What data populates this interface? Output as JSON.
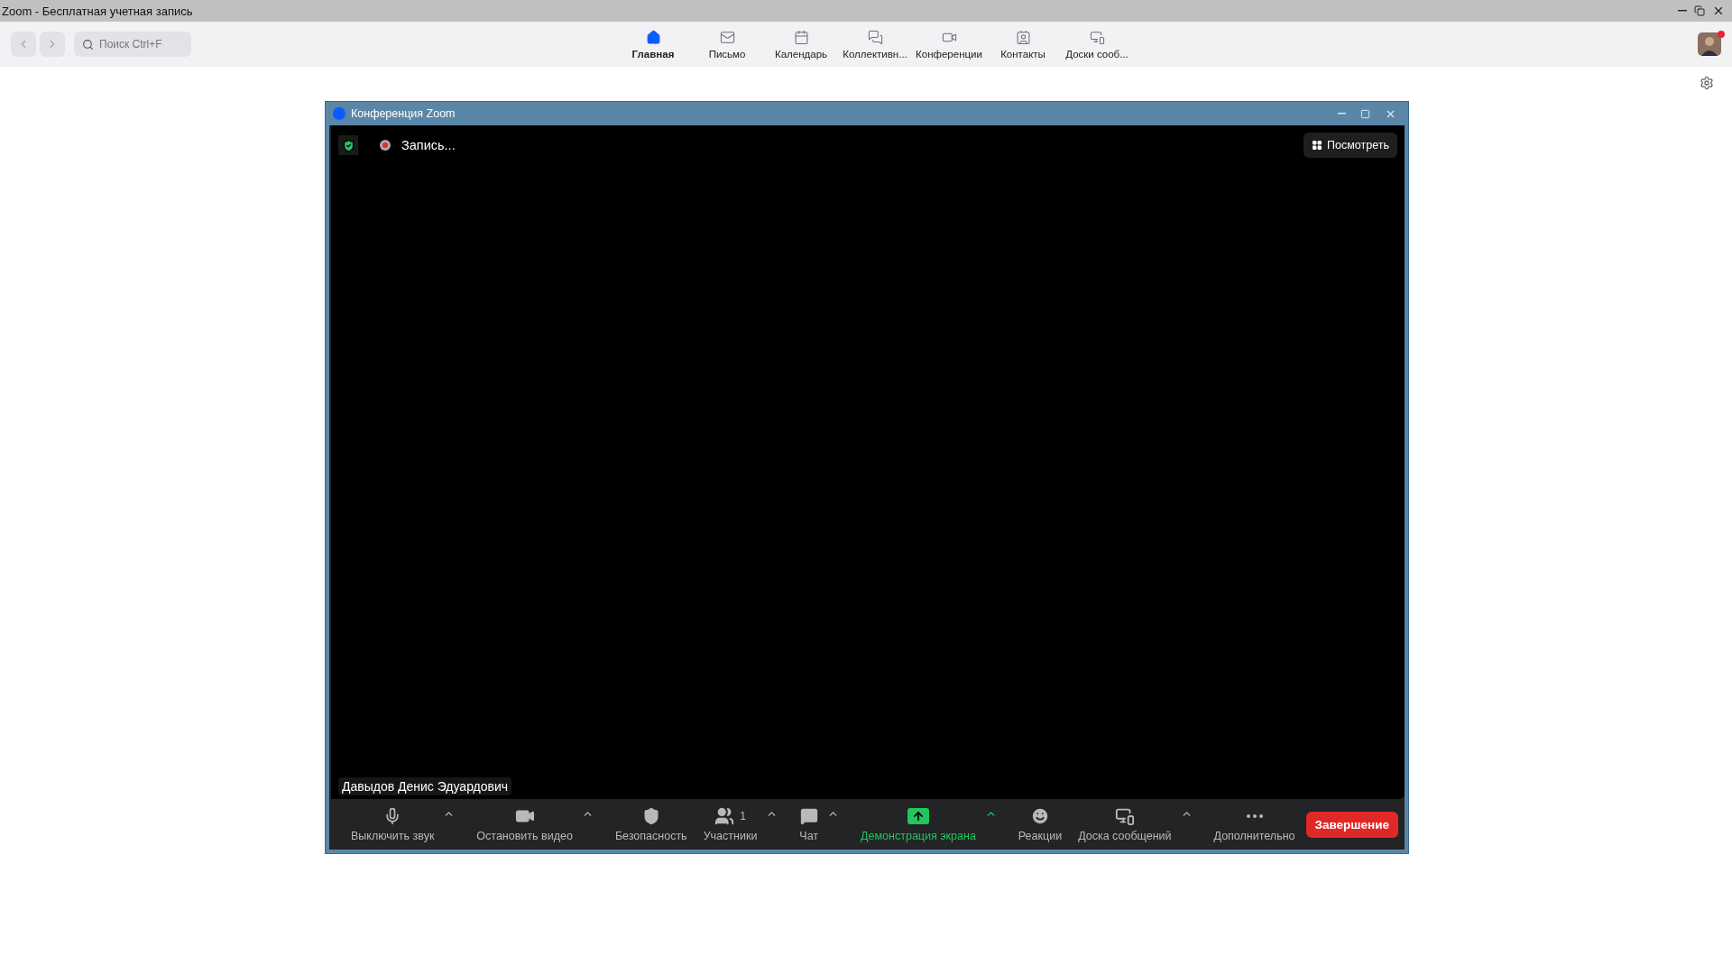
{
  "app_title": "Zoom - Бесплатная учетная запись",
  "search": {
    "placeholder": "Поиск Ctrl+F"
  },
  "nav_tabs": [
    {
      "kind": "home",
      "label": "Главная",
      "selected": true
    },
    {
      "kind": "mail",
      "label": "Письмо",
      "selected": false
    },
    {
      "kind": "calendar",
      "label": "Календарь",
      "selected": false
    },
    {
      "kind": "chat",
      "label": "Коллективн...",
      "selected": false
    },
    {
      "kind": "video",
      "label": "Конференции",
      "selected": false
    },
    {
      "kind": "contacts",
      "label": "Контакты",
      "selected": false
    },
    {
      "kind": "whiteboard",
      "label": "Доски сооб...",
      "selected": false
    }
  ],
  "meeting": {
    "title": "Конференция Zoom",
    "recording": "Запись...",
    "view_button": "Посмотреть",
    "participant_name": "Давыдов Денис Эдуардович",
    "toolbar": [
      {
        "kind": "mic",
        "label": "Выключить звук",
        "menu": true,
        "highlighted": false
      },
      {
        "kind": "camera",
        "label": "Остановить видео",
        "menu": true,
        "highlighted": false
      },
      {
        "kind": "security",
        "label": "Безопасность",
        "menu": false,
        "highlighted": false
      },
      {
        "kind": "participants",
        "label": "Участники",
        "count": "1",
        "menu": true,
        "highlighted": false
      },
      {
        "kind": "chat",
        "label": "Чат",
        "menu": true,
        "highlighted": false
      },
      {
        "kind": "share",
        "label": "Демонстрация экрана",
        "menu": true,
        "highlighted": true
      },
      {
        "kind": "reactions",
        "label": "Реакции",
        "menu": false,
        "highlighted": false
      },
      {
        "kind": "whiteboard",
        "label": "Доска сообщений",
        "menu": true,
        "highlighted": false
      },
      {
        "kind": "more",
        "label": "Дополнительно",
        "menu": false,
        "highlighted": false
      }
    ],
    "end_button": "Завершение"
  }
}
